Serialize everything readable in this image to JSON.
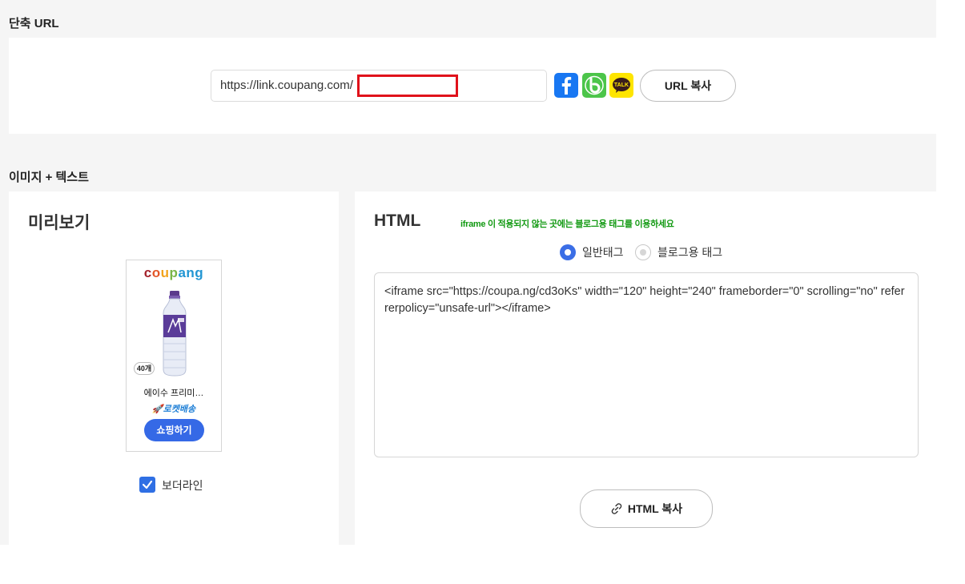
{
  "short_url": {
    "section_title": "단축 URL",
    "url_value": "https://link.coupang.com/",
    "copy_label": "URL 복사",
    "share_icons": [
      "facebook-icon",
      "band-icon",
      "kakaotalk-icon"
    ],
    "talk_text": "TALK"
  },
  "image_text": {
    "section_title": "이미지 + 텍스트"
  },
  "preview": {
    "title": "미리보기",
    "ad": {
      "brand_letters": [
        "c",
        "o",
        "u",
        "p",
        "a",
        "n",
        "g"
      ],
      "brand_colors": [
        "#a4232c",
        "#e35729",
        "#f2a31b",
        "#7ab547",
        "#2296d3",
        "#2296d3",
        "#2296d3"
      ],
      "quantity_badge": "40개",
      "product_name": "에이수 프리미…",
      "delivery": "🚀로켓배송",
      "shop_button": "쇼핑하기"
    },
    "border_checkbox": {
      "label": "보더라인",
      "checked": true
    }
  },
  "html_panel": {
    "title": "HTML",
    "notice": "iframe 이 적용되지 않는 곳에는 블로그용 태그를 이용하세요",
    "radio_options": [
      {
        "label": "일반태그",
        "selected": true
      },
      {
        "label": "블로그용 태그",
        "selected": false
      }
    ],
    "code": "<iframe src=\"https://coupa.ng/cd3oKs\" width=\"120\" height=\"240\" frameborder=\"0\" scrolling=\"no\" referrerpolicy=\"unsafe-url\"></iframe>",
    "copy_label": "HTML 복사"
  },
  "colors": {
    "accent_blue": "#3b6ee6",
    "notice_green": "#119911",
    "redaction_red": "#e0121b"
  }
}
